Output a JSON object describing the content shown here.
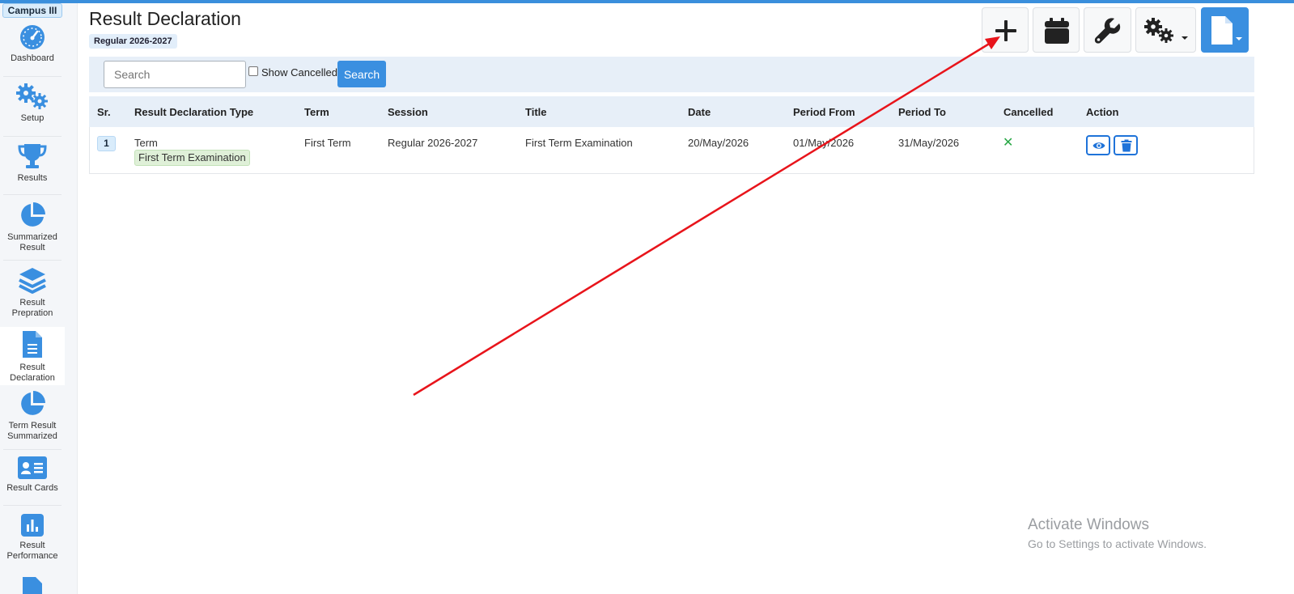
{
  "app": {
    "campus": "Campus III",
    "page_title": "Result Declaration",
    "session_badge": "Regular 2026-2027"
  },
  "sidebar": {
    "items": [
      {
        "label": "Dashboard",
        "icon": "dashboard-gauge-icon"
      },
      {
        "label": "Setup",
        "icon": "gears-icon"
      },
      {
        "label": "Results",
        "icon": "trophy-icon"
      },
      {
        "label": "Summarized Result",
        "icon": "pie-chart-icon"
      },
      {
        "label": "Result Prepration",
        "icon": "layers-icon"
      },
      {
        "label": "Result Declaration",
        "icon": "document-icon",
        "active": true
      },
      {
        "label": "Term Result Summarized",
        "icon": "pie-chart-icon"
      },
      {
        "label": "Result Cards",
        "icon": "id-card-icon"
      },
      {
        "label": "Result Performance",
        "icon": "bar-chart-icon"
      }
    ]
  },
  "toolbar": {
    "buttons": [
      {
        "icon": "plus-icon"
      },
      {
        "icon": "calendar-icon"
      },
      {
        "icon": "wrench-icon"
      },
      {
        "icon": "gears-dropdown-icon"
      },
      {
        "icon": "file-dropdown-icon"
      }
    ]
  },
  "search": {
    "placeholder": "Search",
    "value": "",
    "show_cancelled_label": "Show Cancelled",
    "show_cancelled_checked": false,
    "button_label": "Search"
  },
  "table": {
    "columns": [
      "Sr.",
      "Result Declaration Type",
      "Term",
      "Session",
      "Title",
      "Date",
      "Period From",
      "Period To",
      "Cancelled",
      "Action"
    ],
    "rows": [
      {
        "sr": "1",
        "type": "Term",
        "type_badge": "First Term Examination",
        "term": "First Term",
        "session": "Regular 2026-2027",
        "title": "First Term Examination",
        "date": "20/May/2026",
        "period_from": "01/May/2026",
        "period_to": "31/May/2026",
        "cancelled_icon": "x-icon",
        "actions": [
          "view-icon",
          "delete-icon"
        ]
      }
    ]
  },
  "watermark": {
    "line1": "Activate Windows",
    "line2": "Go to Settings to activate Windows."
  },
  "colors": {
    "accent": "#3a8fe0",
    "annotation_arrow": "#e8141b",
    "cancelled_x": "#28a745"
  }
}
